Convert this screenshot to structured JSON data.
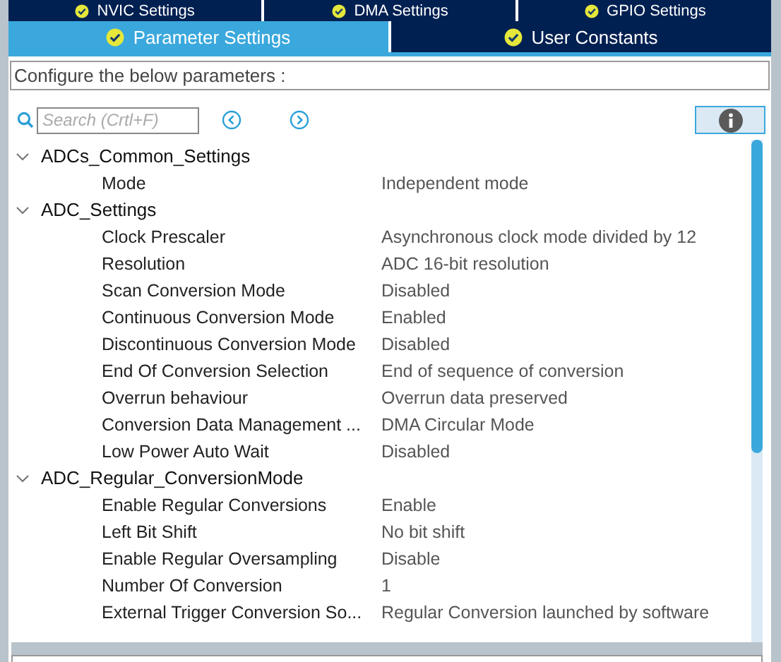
{
  "top_tabs": [
    {
      "label": "NVIC Settings",
      "selected": false
    },
    {
      "label": "DMA Settings",
      "selected": false
    },
    {
      "label": "GPIO Settings",
      "selected": false
    }
  ],
  "tabs": [
    {
      "label": "Parameter Settings",
      "selected": true
    },
    {
      "label": "User Constants",
      "selected": false
    }
  ],
  "description": "Configure the below parameters :",
  "search": {
    "placeholder": "Search (Crtl+F)"
  },
  "tree": [
    {
      "label": "ADCs_Common_Settings",
      "expanded": true,
      "children": [
        {
          "label": "Mode",
          "value": "Independent mode"
        }
      ]
    },
    {
      "label": "ADC_Settings",
      "expanded": true,
      "children": [
        {
          "label": "Clock Prescaler",
          "value": "Asynchronous clock mode divided by 12"
        },
        {
          "label": "Resolution",
          "value": "ADC 16-bit resolution"
        },
        {
          "label": "Scan Conversion Mode",
          "value": "Disabled"
        },
        {
          "label": "Continuous Conversion Mode",
          "value": "Enabled"
        },
        {
          "label": "Discontinuous Conversion Mode",
          "value": "Disabled"
        },
        {
          "label": "End Of Conversion Selection",
          "value": "End of sequence of conversion"
        },
        {
          "label": "Overrun behaviour",
          "value": "Overrun data preserved"
        },
        {
          "label": "Conversion Data Management ...",
          "value": "DMA Circular Mode"
        },
        {
          "label": "Low Power Auto Wait",
          "value": "Disabled"
        }
      ]
    },
    {
      "label": "ADC_Regular_ConversionMode",
      "expanded": true,
      "children": [
        {
          "label": "Enable Regular Conversions",
          "value": "Enable"
        },
        {
          "label": "Left Bit Shift",
          "value": "No bit shift"
        },
        {
          "label": "Enable Regular Oversampling",
          "value": "Disable"
        },
        {
          "label": "Number Of Conversion",
          "value": "1"
        },
        {
          "label": "External Trigger Conversion So...",
          "value": "Regular Conversion launched by software"
        }
      ]
    }
  ]
}
